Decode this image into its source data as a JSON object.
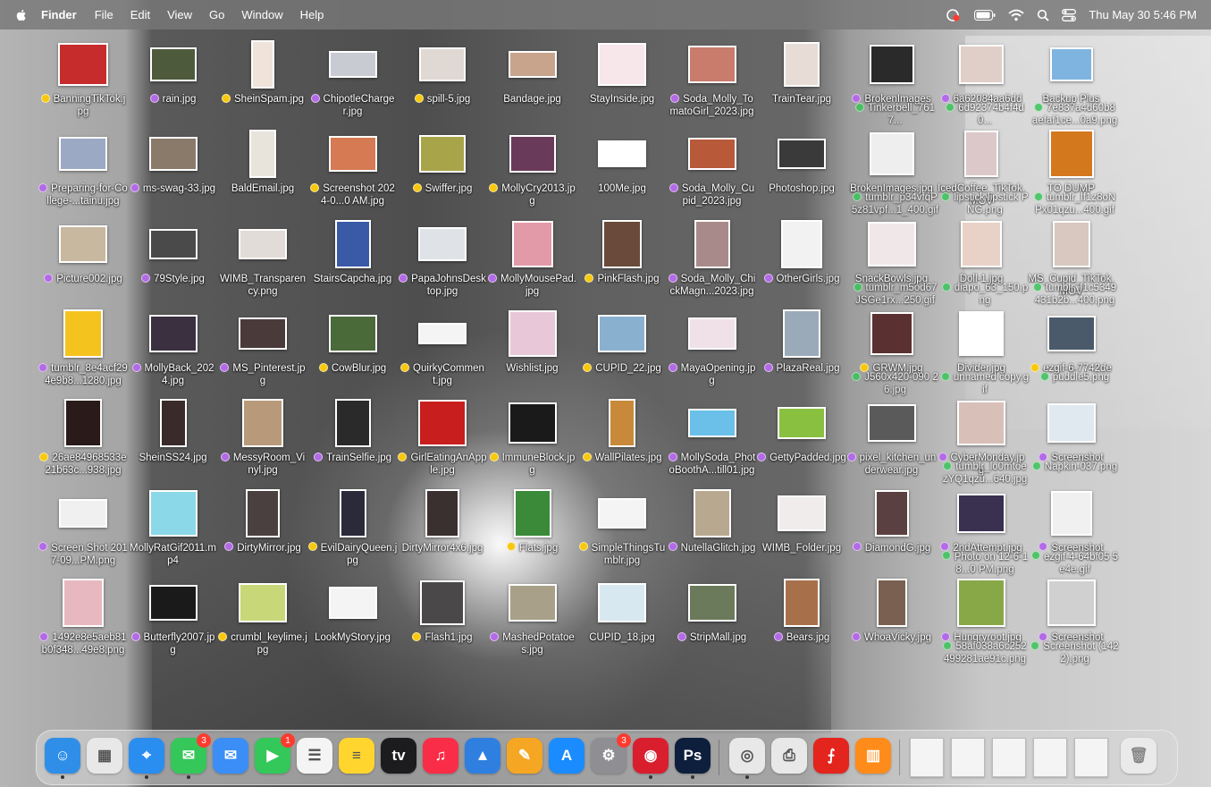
{
  "menubar": {
    "app_name": "Finder",
    "menus": [
      "File",
      "Edit",
      "View",
      "Go",
      "Window",
      "Help"
    ],
    "clock": "Thu May 30  5:46 PM",
    "status_icons": [
      "screen-recording-icon",
      "battery-icon",
      "wifi-icon",
      "spotlight-search-icon",
      "control-center-icon"
    ]
  },
  "tag_colors": {
    "yellow": "#f7c80d",
    "purple": "#b36ae6",
    "green": "#3cc45a"
  },
  "desktop": {
    "items": [
      {
        "label": "BanningTikTok.jpg",
        "tag": "yellow",
        "thumb": "#c62c2c",
        "w": 52,
        "h": 44
      },
      {
        "label": "rain.jpg",
        "tag": "purple",
        "thumb": "#4e5a3c",
        "w": 48,
        "h": 34
      },
      {
        "label": "SheinSpam.jpg",
        "tag": "yellow",
        "thumb": "#efe3da",
        "w": 22,
        "h": 50
      },
      {
        "label": "ChipotleCharger.jpg",
        "tag": "purple",
        "thumb": "#c8ccd2",
        "w": 50,
        "h": 26
      },
      {
        "label": "spill-5.jpg",
        "tag": "yellow",
        "thumb": "#dfd8d3",
        "w": 48,
        "h": 34
      },
      {
        "label": "Bandage.jpg",
        "tag": "",
        "thumb": "#c8a48c",
        "w": 50,
        "h": 26
      },
      {
        "label": "StayInside.jpg",
        "tag": "",
        "thumb": "#f7e6ea",
        "w": 50,
        "h": 44
      },
      {
        "label": "Soda_Molly_TomatoGirl_2023.jpg",
        "tag": "purple",
        "thumb": "#c97b6c",
        "w": 50,
        "h": 38
      },
      {
        "label": "TrainTear.jpg",
        "tag": "",
        "thumb": "#e7ddd6",
        "w": 36,
        "h": 46
      },
      {
        "label": "BrokenImages",
        "tag": "purple",
        "thumb": "#2a2a2a",
        "w": 46,
        "h": 40
      },
      {
        "label": "6a62084aa6dd",
        "tag": "purple",
        "thumb": "#e0cfc8",
        "w": 46,
        "h": 40
      },
      {
        "label": "Backup Plus",
        "tag": "",
        "thumb": "#7fb4e0",
        "w": 44,
        "h": 34
      },
      {
        "label": "Preparing-for-College-...tainu.jpg",
        "tag": "purple",
        "thumb": "#9ba9c4",
        "w": 50,
        "h": 34
      },
      {
        "label": "ms-swag-33.jpg",
        "tag": "purple",
        "thumb": "#8a7a6a",
        "w": 50,
        "h": 34
      },
      {
        "label": "BaldEmail.jpg",
        "tag": "",
        "thumb": "#e8e4dc",
        "w": 26,
        "h": 50
      },
      {
        "label": "Screenshot 2024-0...0 AM.jpg",
        "tag": "yellow",
        "thumb": "#d57a53",
        "w": 50,
        "h": 36
      },
      {
        "label": "Swiffer.jpg",
        "tag": "yellow",
        "thumb": "#a8a44a",
        "w": 48,
        "h": 38
      },
      {
        "label": "MollyCry2013.jpg",
        "tag": "yellow",
        "thumb": "#6a3a5a",
        "w": 48,
        "h": 38
      },
      {
        "label": "100Me.jpg",
        "tag": "",
        "thumb": "#ffffff",
        "w": 50,
        "h": 26
      },
      {
        "label": "Soda_Molly_Cupid_2023.jpg",
        "tag": "purple",
        "thumb": "#b85a3a",
        "w": 50,
        "h": 32
      },
      {
        "label": "Photoshop.jpg",
        "tag": "",
        "thumb": "#3a3a3a",
        "w": 50,
        "h": 30
      },
      {
        "label": "BrokenImages.jpg",
        "tag": "",
        "thumb": "#eeeeee",
        "w": 46,
        "h": 44
      },
      {
        "label": "IcedCoffee_TikTok.MOV",
        "tag": "",
        "thumb": "#dcc8c8",
        "w": 34,
        "h": 48
      },
      {
        "label": "TO DUMP",
        "tag": "",
        "thumb": "#d4781e",
        "w": 46,
        "h": 50
      },
      {
        "label": "Picture002.jpg",
        "tag": "purple",
        "thumb": "#c9b8a0",
        "w": 50,
        "h": 38
      },
      {
        "label": "79Style.jpg",
        "tag": "purple",
        "thumb": "#4a4a4a",
        "w": 50,
        "h": 30
      },
      {
        "label": "WIMB_Transparency.png",
        "tag": "",
        "thumb": "#e2dcd8",
        "w": 50,
        "h": 30
      },
      {
        "label": "StairsCapcha.jpg",
        "tag": "",
        "thumb": "#3a5aa8",
        "w": 36,
        "h": 50
      },
      {
        "label": "PapaJohnsDesktop.jpg",
        "tag": "purple",
        "thumb": "#dfe3e8",
        "w": 50,
        "h": 34
      },
      {
        "label": "MollyMousePad.jpg",
        "tag": "purple",
        "thumb": "#e39aa8",
        "w": 42,
        "h": 48
      },
      {
        "label": "PinkFlash.jpg",
        "tag": "yellow",
        "thumb": "#6a4a3a",
        "w": 40,
        "h": 50
      },
      {
        "label": "Soda_Molly_ChickMagn...2023.jpg",
        "tag": "purple",
        "thumb": "#a88a8a",
        "w": 36,
        "h": 50
      },
      {
        "label": "OtherGirls.jpg",
        "tag": "purple",
        "thumb": "#f2f2f2",
        "w": 42,
        "h": 50
      },
      {
        "label": "SnackBowls.jpg",
        "tag": "",
        "thumb": "#f0e8e8",
        "w": 50,
        "h": 46
      },
      {
        "label": "Doll-1.jpg",
        "tag": "",
        "thumb": "#e8d2c8",
        "w": 42,
        "h": 48
      },
      {
        "label": "MS_Cupid_TikTok.MOV",
        "tag": "",
        "thumb": "#d8c8c0",
        "w": 38,
        "h": 48
      },
      {
        "label": "tumblr_8e4acf294e9b8...1280.jpg",
        "tag": "purple",
        "thumb": "#f5c31e",
        "w": 40,
        "h": 50
      },
      {
        "label": "MollyBack_2024.jpg",
        "tag": "purple",
        "thumb": "#3a3040",
        "w": 50,
        "h": 38
      },
      {
        "label": "MS_Pinterest.jpg",
        "tag": "purple",
        "thumb": "#4a3a3a",
        "w": 50,
        "h": 32
      },
      {
        "label": "CowBlur.jpg",
        "tag": "yellow",
        "thumb": "#4a6a3a",
        "w": 50,
        "h": 38
      },
      {
        "label": "QuirkyComment.jpg",
        "tag": "yellow",
        "thumb": "#f4f4f4",
        "w": 50,
        "h": 20
      },
      {
        "label": "Wishlist.jpg",
        "tag": "",
        "thumb": "#e8c8d8",
        "w": 50,
        "h": 48
      },
      {
        "label": "CUPID_22.jpg",
        "tag": "yellow",
        "thumb": "#8ab0d0",
        "w": 50,
        "h": 38
      },
      {
        "label": "MayaOpening.jpg",
        "tag": "purple",
        "thumb": "#f0e0e8",
        "w": 50,
        "h": 32
      },
      {
        "label": "PlazaReal.jpg",
        "tag": "purple",
        "thumb": "#9aaab8",
        "w": 38,
        "h": 50
      },
      {
        "label": "GRWM.jpg",
        "tag": "yellow",
        "thumb": "#5a3030",
        "w": 44,
        "h": 44
      },
      {
        "label": "Divider.jpg",
        "tag": "",
        "thumb": "#ffffff",
        "w": 46,
        "h": 46
      },
      {
        "label": "ezgif-6-7742de",
        "tag": "yellow",
        "thumb": "#4a5a6a",
        "w": 50,
        "h": 36
      },
      {
        "label": "26ae84968533e21b63c...938.jpg",
        "tag": "yellow",
        "thumb": "#2a1a1a",
        "w": 38,
        "h": 50
      },
      {
        "label": "SheinSS24.jpg",
        "tag": "",
        "thumb": "#3a2a2a",
        "w": 26,
        "h": 50
      },
      {
        "label": "MessyRoom_Vinyl.jpg",
        "tag": "purple",
        "thumb": "#b89a7a",
        "w": 42,
        "h": 50
      },
      {
        "label": "TrainSelfie.jpg",
        "tag": "purple",
        "thumb": "#2a2a2a",
        "w": 36,
        "h": 50
      },
      {
        "label": "GirlEatingAnApple.jpg",
        "tag": "yellow",
        "thumb": "#c81e1e",
        "w": 50,
        "h": 48
      },
      {
        "label": "ImmuneBlock.jpg",
        "tag": "yellow",
        "thumb": "#1a1a1a",
        "w": 50,
        "h": 42
      },
      {
        "label": "WallPilates.jpg",
        "tag": "yellow",
        "thumb": "#c88a3a",
        "w": 26,
        "h": 50
      },
      {
        "label": "MollySoda_PhotoBoothA...till01.jpg",
        "tag": "purple",
        "thumb": "#6ac0e8",
        "w": 50,
        "h": 28
      },
      {
        "label": "GettyPadded.jpg",
        "tag": "purple",
        "thumb": "#8ac040",
        "w": 50,
        "h": 32
      },
      {
        "label": "pixel_kitchen_underwear.jpg",
        "tag": "purple",
        "thumb": "#5a5a5a",
        "w": 50,
        "h": 38
      },
      {
        "label": "CyberMonday.jpg",
        "tag": "purple",
        "thumb": "#d8c0b8",
        "w": 50,
        "h": 46
      },
      {
        "label": "Screenshot",
        "tag": "purple",
        "thumb": "#e0e8f0",
        "w": 50,
        "h": 40
      },
      {
        "label": "Screen Shot 2017-09...PM.png",
        "tag": "purple",
        "thumb": "#f0f0f0",
        "w": 50,
        "h": 28
      },
      {
        "label": "MollyRatGif2011.mp4",
        "tag": "",
        "thumb": "#8ad8e8",
        "w": 50,
        "h": 48
      },
      {
        "label": "DirtyMirror.jpg",
        "tag": "purple",
        "thumb": "#4a4040",
        "w": 34,
        "h": 50
      },
      {
        "label": "EvilDairyQueen.jpg",
        "tag": "yellow",
        "thumb": "#2a2a3a",
        "w": 26,
        "h": 50
      },
      {
        "label": "DirtyMirror4x6.jpg",
        "tag": "",
        "thumb": "#3a3030",
        "w": 34,
        "h": 50
      },
      {
        "label": "Flats.jpg",
        "tag": "yellow",
        "thumb": "#3a8a3a",
        "w": 38,
        "h": 50
      },
      {
        "label": "SimpleThingsTumblr.jpg",
        "tag": "yellow",
        "thumb": "#f4f4f4",
        "w": 50,
        "h": 30
      },
      {
        "label": "NutellaGlitch.jpg",
        "tag": "purple",
        "thumb": "#b8a890",
        "w": 38,
        "h": 50
      },
      {
        "label": "WIMB_Folder.jpg",
        "tag": "",
        "thumb": "#f0ecec",
        "w": 50,
        "h": 36
      },
      {
        "label": "DiamondG.jpg",
        "tag": "purple",
        "thumb": "#5a4040",
        "w": 34,
        "h": 48
      },
      {
        "label": "2ndAttempt.jpg",
        "tag": "purple",
        "thumb": "#3a3050",
        "w": 50,
        "h": 40
      },
      {
        "label": "Screenshot",
        "tag": "purple",
        "thumb": "#f0f0f0",
        "w": 42,
        "h": 46
      },
      {
        "label": "1492e8e5aeb81b0f348...49e8.png",
        "tag": "purple",
        "thumb": "#e8b8c0",
        "w": 42,
        "h": 50
      },
      {
        "label": "Butterfly2007.jpg",
        "tag": "purple",
        "thumb": "#1a1a1a",
        "w": 50,
        "h": 36
      },
      {
        "label": "crumbl_keylime.jpg",
        "tag": "yellow",
        "thumb": "#c8d878",
        "w": 50,
        "h": 40
      },
      {
        "label": "LookMyStory.jpg",
        "tag": "",
        "thumb": "#f4f4f4",
        "w": 50,
        "h": 32
      },
      {
        "label": "Flash1.jpg",
        "tag": "yellow",
        "thumb": "#4a4848",
        "w": 46,
        "h": 46
      },
      {
        "label": "MashedPotatoes.jpg",
        "tag": "purple",
        "thumb": "#a8a088",
        "w": 50,
        "h": 38
      },
      {
        "label": "CUPID_18.jpg",
        "tag": "",
        "thumb": "#d8e8f0",
        "w": 50,
        "h": 40
      },
      {
        "label": "StripMall.jpg",
        "tag": "purple",
        "thumb": "#6a7a5a",
        "w": 50,
        "h": 38
      },
      {
        "label": "Bears.jpg",
        "tag": "purple",
        "thumb": "#a8704a",
        "w": 36,
        "h": 50
      },
      {
        "label": "WhoaVicky.jpg",
        "tag": "purple",
        "thumb": "#7a6050",
        "w": 30,
        "h": 50
      },
      {
        "label": "Hungryroot.jpg",
        "tag": "purple",
        "thumb": "#88a848",
        "w": 50,
        "h": 50
      },
      {
        "label": "Screenshot",
        "tag": "purple",
        "thumb": "#d0d0d0",
        "w": 50,
        "h": 48
      }
    ],
    "overlap_labels": [
      {
        "col": 9,
        "row": 0,
        "text": "Tinkerbell_7617..."
      },
      {
        "col": 10,
        "row": 0,
        "text": "6d92374b4f4d0..."
      },
      {
        "col": 11,
        "row": 0,
        "text": "7e837a4d60b8 aefaf1ce...0a9.png"
      },
      {
        "col": 9,
        "row": 1,
        "text": "tumblr_p34vfqP 5z81vpf...1_400.gif"
      },
      {
        "col": 10,
        "row": 1,
        "text": "lipstick lipstick PNG.png"
      },
      {
        "col": 11,
        "row": 1,
        "text": "tumblr_lf1z8oN Px01qzu...400.gif"
      },
      {
        "col": 9,
        "row": 2,
        "text": "tumblr_m5od67 JSGe1rx...250.gif"
      },
      {
        "col": 10,
        "row": 2,
        "text": "diapo_63_150.png"
      },
      {
        "col": 11,
        "row": 2,
        "text": "tumblr_f1c5349 431b2b...400.png"
      },
      {
        "col": 9,
        "row": 3,
        "text": "J560x420-090 26.jpg"
      },
      {
        "col": 10,
        "row": 3,
        "text": "unnamed copy.gif"
      },
      {
        "col": 11,
        "row": 3,
        "text": "puddle5.png"
      },
      {
        "col": 10,
        "row": 4,
        "text": "tumblr_lo0mtoe zYQ1qzu...640.jpg"
      },
      {
        "col": 11,
        "row": 4,
        "text": "Napkin-037.png"
      },
      {
        "col": 10,
        "row": 5,
        "text": "Photo on 12-6-18...0 PM.png"
      },
      {
        "col": 11,
        "row": 5,
        "text": "ezgif-4-64bf05 5e4e.gif"
      },
      {
        "col": 10,
        "row": 6,
        "text": "58af038a6c252 499281ae91c.png"
      },
      {
        "col": 11,
        "row": 6,
        "text": "Screenshot (1422).png"
      }
    ]
  },
  "dock": {
    "apps": [
      {
        "name": "finder-icon",
        "glyph": "☺",
        "color": "#2f8fe8",
        "badge": "",
        "running": true
      },
      {
        "name": "launchpad-icon",
        "glyph": "▦",
        "color": "#e8e8e8",
        "badge": "",
        "running": false
      },
      {
        "name": "safari-icon",
        "glyph": "⌖",
        "color": "#2a8ef0",
        "badge": "",
        "running": true
      },
      {
        "name": "messages-icon",
        "glyph": "✉",
        "color": "#35c759",
        "badge": "3",
        "running": true
      },
      {
        "name": "mail-icon",
        "glyph": "✉",
        "color": "#3a8ef6",
        "badge": "",
        "running": false
      },
      {
        "name": "facetime-icon",
        "glyph": "▶",
        "color": "#34c759",
        "badge": "1",
        "running": false
      },
      {
        "name": "reminders-icon",
        "glyph": "☰",
        "color": "#f4f4f4",
        "badge": "",
        "running": false
      },
      {
        "name": "notes-icon",
        "glyph": "≡",
        "color": "#ffd52e",
        "badge": "",
        "running": false
      },
      {
        "name": "apple-tv-icon",
        "glyph": "tv",
        "color": "#1c1c1e",
        "badge": "",
        "running": false
      },
      {
        "name": "music-icon",
        "glyph": "♫",
        "color": "#fa2d48",
        "badge": "",
        "running": false
      },
      {
        "name": "keynote-icon",
        "glyph": "▲",
        "color": "#2f7fe0",
        "badge": "",
        "running": false
      },
      {
        "name": "pages-icon",
        "glyph": "✎",
        "color": "#f5a623",
        "badge": "",
        "running": false
      },
      {
        "name": "app-store-icon",
        "glyph": "A",
        "color": "#1a8cff",
        "badge": "",
        "running": false
      },
      {
        "name": "system-settings-icon",
        "glyph": "⚙",
        "color": "#8e8e93",
        "badge": "3",
        "running": false
      },
      {
        "name": "photo-booth-icon",
        "glyph": "◉",
        "color": "#d91e2e",
        "badge": "",
        "running": true
      },
      {
        "name": "photoshop-icon",
        "glyph": "Ps",
        "color": "#0d1f3c",
        "badge": "",
        "running": true
      },
      {
        "name": "chrome-icon",
        "glyph": "◎",
        "color": "#e8e8e8",
        "badge": "",
        "running": true
      },
      {
        "name": "printer-icon",
        "glyph": "⎙",
        "color": "#e8e8e8",
        "badge": "",
        "running": false
      },
      {
        "name": "acrobat-icon",
        "glyph": "⨍",
        "color": "#e3251e",
        "badge": "",
        "running": false
      },
      {
        "name": "books-icon",
        "glyph": "▥",
        "color": "#ff8c1a",
        "badge": "",
        "running": false
      }
    ],
    "doc_stacks": [
      "pdf-document-icon",
      "recent-document-1-icon",
      "recent-document-2-icon",
      "recent-document-3-icon",
      "recent-document-4-icon"
    ],
    "trash": "trash-icon"
  }
}
